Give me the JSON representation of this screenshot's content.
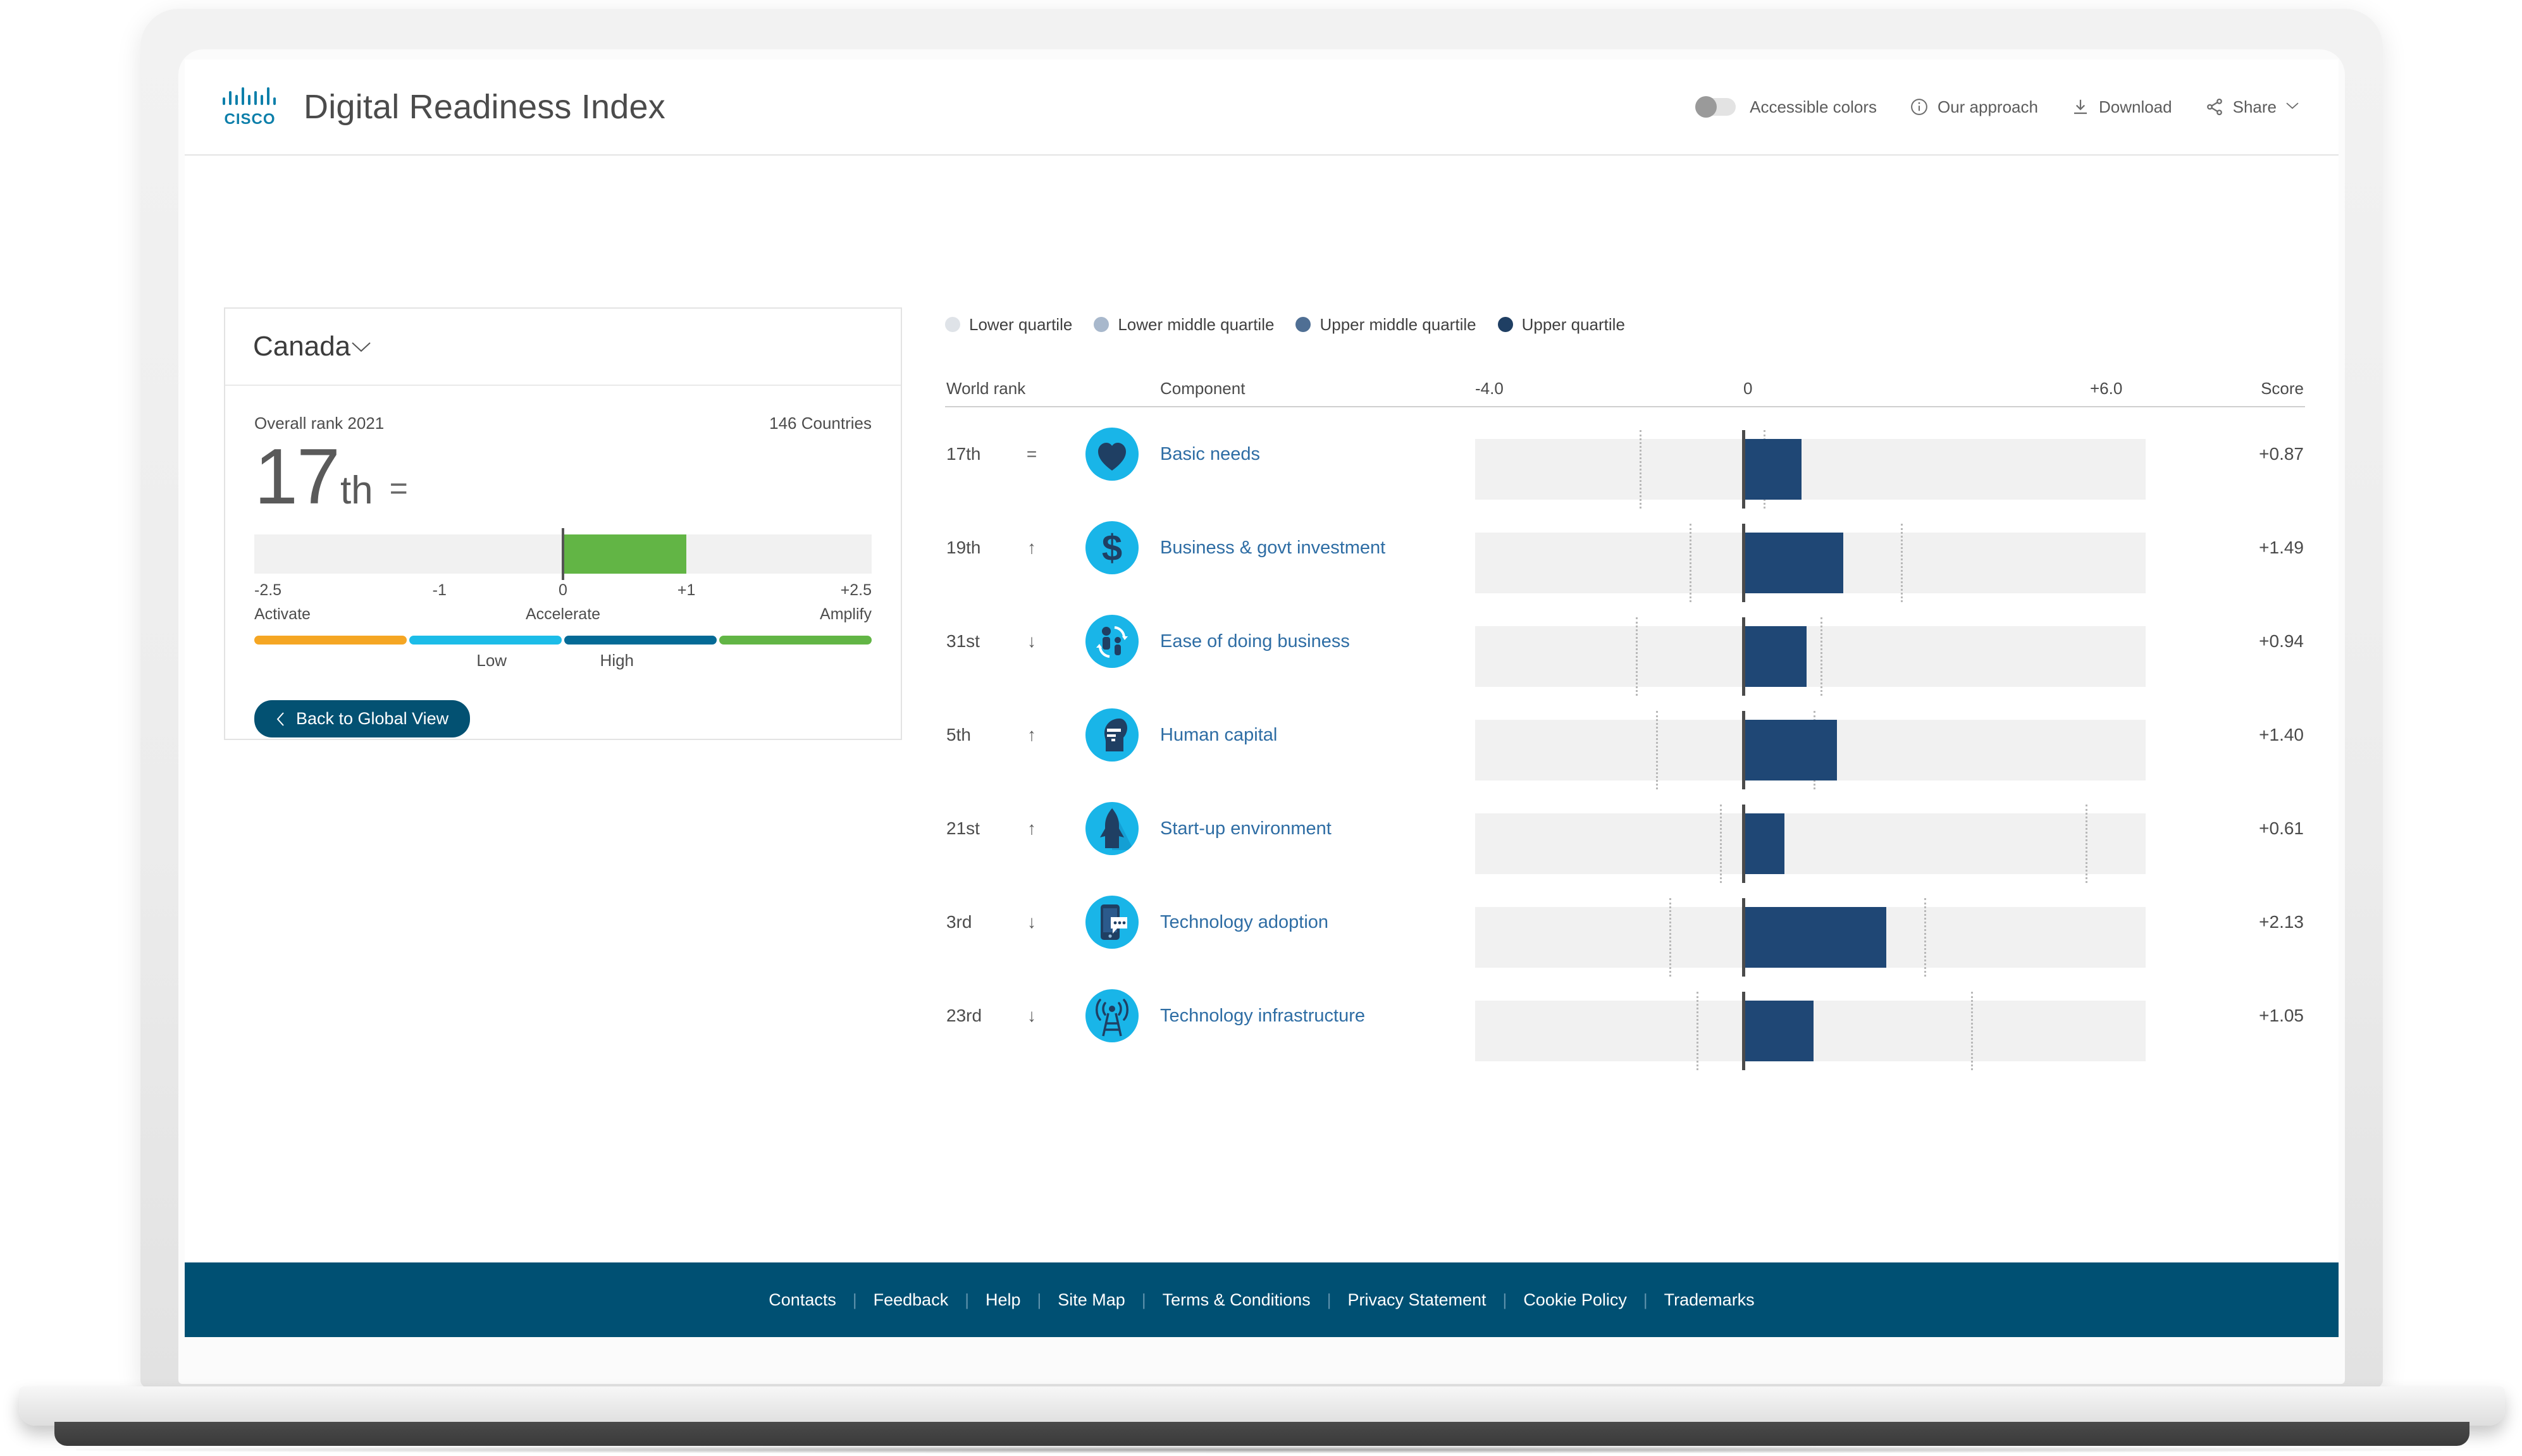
{
  "header": {
    "logo_icon": "cisco-logo",
    "title": "Digital Readiness Index",
    "accessible_colors_label": "Accessible colors",
    "accessible_colors_on": false,
    "our_approach_label": "Our approach",
    "our_approach_icon": "info-circle-icon",
    "download_label": "Download",
    "download_icon": "download-icon",
    "share_label": "Share",
    "share_icon": "share-icon",
    "share_caret": "chevron-down-icon"
  },
  "country_card": {
    "selected_country": "Canada",
    "dropdown_icon": "chevron-down-icon",
    "overall_rank_label": "Overall rank 2021",
    "countries_count_label": "146 Countries",
    "rank_number": "17",
    "rank_suffix": "th",
    "rank_change": "=",
    "gauge": {
      "min": -2.5,
      "max": 2.5,
      "value": 1.0,
      "zero": 0,
      "fill_color": "#62b545",
      "ticks": [
        {
          "label": "-2.5",
          "value": -2.5
        },
        {
          "label": "-1",
          "value": -1
        },
        {
          "label": "0",
          "value": 0
        },
        {
          "label": "+1",
          "value": 1
        },
        {
          "label": "+2.5",
          "value": 2.5
        }
      ],
      "stage_names": [
        {
          "label": "Activate",
          "value": -2.5
        },
        {
          "label": "Accelerate",
          "value": 0
        },
        {
          "label": "Amplify",
          "value": 2.5
        }
      ]
    },
    "stage_bar": {
      "segments": [
        {
          "color": "#f5a623"
        },
        {
          "color": "#1cbce8"
        },
        {
          "color": "#046a96"
        },
        {
          "color": "#62b545"
        }
      ],
      "low_label": "Low",
      "high_label": "High"
    },
    "back_button_label": "Back to Global View",
    "back_button_icon": "chevron-left-icon",
    "back_button_color": "#035172"
  },
  "quartile_legend": [
    {
      "label": "Lower quartile",
      "color": "#dfe3e8"
    },
    {
      "label": "Lower middle quartile",
      "color": "#a8b8cc"
    },
    {
      "label": "Upper middle quartile",
      "color": "#4f6f94"
    },
    {
      "label": "Upper quartile",
      "color": "#1f3f63"
    }
  ],
  "table_headers": {
    "world_rank": "World rank",
    "component": "Component",
    "axis_min": "-4.0",
    "axis_zero": "0",
    "axis_max": "+6.0",
    "score": "Score"
  },
  "chart_data": {
    "type": "bar",
    "title": "Digital Readiness Index — Canada component scores",
    "xlabel": "",
    "ylabel": "",
    "xlim": [
      -4.0,
      6.0
    ],
    "grid": false,
    "legend_position": "top",
    "categories": [
      "Basic needs",
      "Business & govt investment",
      "Ease of doing business",
      "Human capital",
      "Start-up environment",
      "Technology adoption",
      "Technology infrastructure"
    ],
    "values": [
      0.87,
      1.49,
      0.94,
      1.4,
      0.61,
      2.13,
      1.05
    ],
    "bar_color": "#1f4775",
    "track_color": "#f1f1f1",
    "rows": [
      {
        "rank": "17th",
        "change": "=",
        "change_icon": "equals-icon",
        "component": "Basic needs",
        "icon": "heart-icon",
        "score": "+0.87",
        "value": 0.87,
        "quartile_markers": [
          -1.55,
          0.3
        ]
      },
      {
        "rank": "19th",
        "change": "↑",
        "change_icon": "arrow-up-icon",
        "component": "Business & govt investment",
        "icon": "dollar-icon",
        "score": "+1.49",
        "value": 1.49,
        "quartile_markers": [
          -0.8,
          2.35
        ]
      },
      {
        "rank": "31st",
        "change": "↓",
        "change_icon": "arrow-down-icon",
        "component": "Ease of doing business",
        "icon": "people-cycle-icon",
        "score": "+0.94",
        "value": 0.94,
        "quartile_markers": [
          -1.6,
          1.15
        ]
      },
      {
        "rank": "5th",
        "change": "↑",
        "change_icon": "arrow-up-icon",
        "component": "Human capital",
        "icon": "head-education-icon",
        "score": "+1.40",
        "value": 1.4,
        "quartile_markers": [
          -1.3,
          1.05
        ]
      },
      {
        "rank": "21st",
        "change": "↑",
        "change_icon": "arrow-up-icon",
        "component": "Start-up environment",
        "icon": "rocket-arrow-icon",
        "score": "+0.61",
        "value": 0.61,
        "quartile_markers": [
          -0.35,
          5.1
        ]
      },
      {
        "rank": "3rd",
        "change": "↓",
        "change_icon": "arrow-down-icon",
        "component": "Technology adoption",
        "icon": "smartphone-chat-icon",
        "score": "+2.13",
        "value": 2.13,
        "quartile_markers": [
          -1.1,
          2.7
        ]
      },
      {
        "rank": "23rd",
        "change": "↓",
        "change_icon": "arrow-down-icon",
        "component": "Technology infrastructure",
        "icon": "broadcast-tower-icon",
        "score": "+1.05",
        "value": 1.05,
        "quartile_markers": [
          -0.7,
          3.4
        ]
      }
    ]
  },
  "footer": {
    "background": "#005073",
    "links": [
      "Contacts",
      "Feedback",
      "Help",
      "Site Map",
      "Terms & Conditions",
      "Privacy Statement",
      "Cookie Policy",
      "Trademarks"
    ]
  }
}
